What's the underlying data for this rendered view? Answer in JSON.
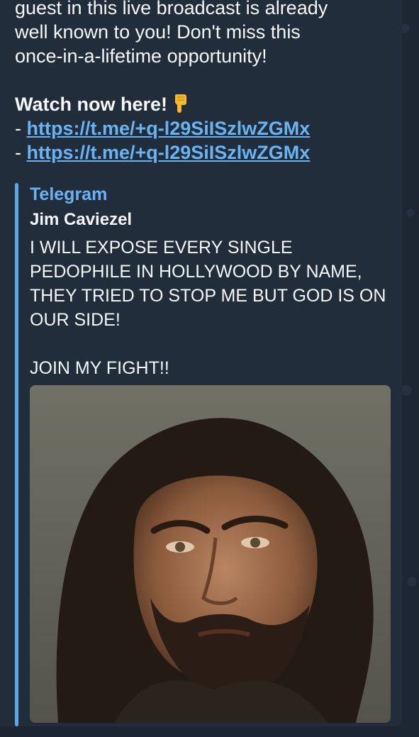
{
  "message": {
    "lines": [
      "guest in this live broadcast is already",
      "well known to you! Don't miss this",
      "once-in-a-lifetime opportunity!"
    ],
    "cta": "Watch now here!",
    "cta_icon": "pointing-down-hand-icon",
    "links": [
      "https://t.me/+q-l29SiISzlwZGMx",
      "https://t.me/+q-l29SiISzlwZGMx"
    ],
    "link_prefix": "- "
  },
  "preview": {
    "site_name": "Telegram",
    "title": "Jim Caviezel",
    "description_lines": [
      "I WILL EXPOSE EVERY SINGLE",
      "PEDOPHILE IN HOLLYWOOD BY NAME,",
      "THEY TRIED TO STOP ME BUT GOD IS ON",
      "OUR SIDE!",
      "",
      "JOIN MY FIGHT!!"
    ],
    "image": "portrait-photo-of-long-haired-bearded-man"
  },
  "colors": {
    "background": "#1b2430",
    "bubble": "#212d3b",
    "text": "#f5f7fa",
    "link": "#6ab3f3",
    "accent_bar": "#5fa8e8"
  }
}
